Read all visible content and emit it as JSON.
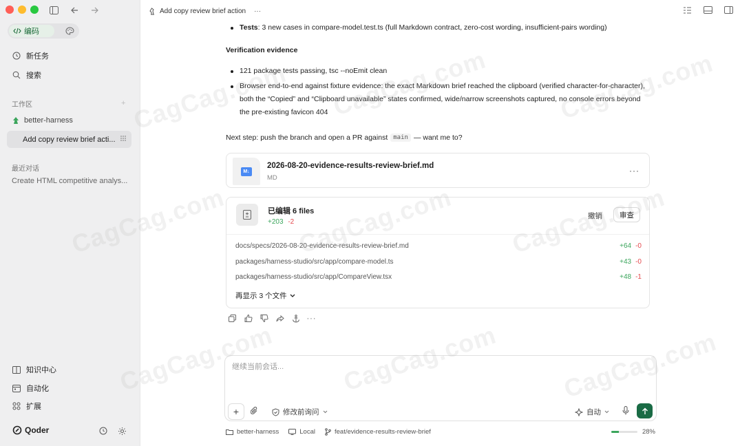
{
  "sidebar": {
    "mode_active": "编码",
    "new_task": "新任务",
    "search": "搜索",
    "workspace_label": "工作区",
    "workspace_name": "better-harness",
    "active_thread": "Add copy review brief acti...",
    "recent_label": "最近对话",
    "recent_item": "Create HTML competitive analys...",
    "knowledge": "知识中心",
    "automation": "自动化",
    "extensions": "扩展",
    "brand": "Qoder"
  },
  "header": {
    "title": "Add copy review brief action",
    "more": "···"
  },
  "message": {
    "tests_label": "Tests",
    "tests_text": ": 3 new cases in compare-model.test.ts (full Markdown contract, zero-cost wording, insufficient-pairs wording)",
    "evidence_heading": "Verification evidence",
    "evidence_1": "121 package tests passing, tsc --noEmit clean",
    "evidence_2": "Browser end-to-end against fixture evidence: the exact Markdown brief reached the clipboard (verified character-for-character), both the “Copied” and “Clipboard unavailable” states confirmed, wide/narrow screenshots captured, no console errors beyond the pre-existing favicon 404",
    "next_prefix": "Next step: push the branch and open a PR against",
    "next_code": "main",
    "next_suffix": "— want me to?"
  },
  "file_card": {
    "name": "2026-08-20-evidence-results-review-brief.md",
    "type": "MD",
    "badge": "M↓",
    "more": "···"
  },
  "edit_card": {
    "title": "已编辑 6 files",
    "additions": "+203",
    "deletions": "-2",
    "undo": "撤销",
    "review": "审查",
    "files": [
      {
        "path": "docs/specs/2026-08-20-evidence-results-review-brief.md",
        "add": "+64",
        "del": "-0"
      },
      {
        "path": "packages/harness-studio/src/app/compare-model.ts",
        "add": "+43",
        "del": "-0"
      },
      {
        "path": "packages/harness-studio/src/app/CompareView.tsx",
        "add": "+48",
        "del": "-1"
      }
    ],
    "show_more": "再显示 3 个文件"
  },
  "composer": {
    "placeholder": "继续当前会话...",
    "mode": "修改前询问",
    "model": "自动"
  },
  "status_bar": {
    "project": "better-harness",
    "env": "Local",
    "branch": "feat/evidence-results-review-brief",
    "progress_label": "28%",
    "progress_value": 0.28
  },
  "watermark": "CagCag.com",
  "colors": {
    "accent": "#1a6b45",
    "add": "#3ba55c",
    "del": "#e5484d"
  }
}
